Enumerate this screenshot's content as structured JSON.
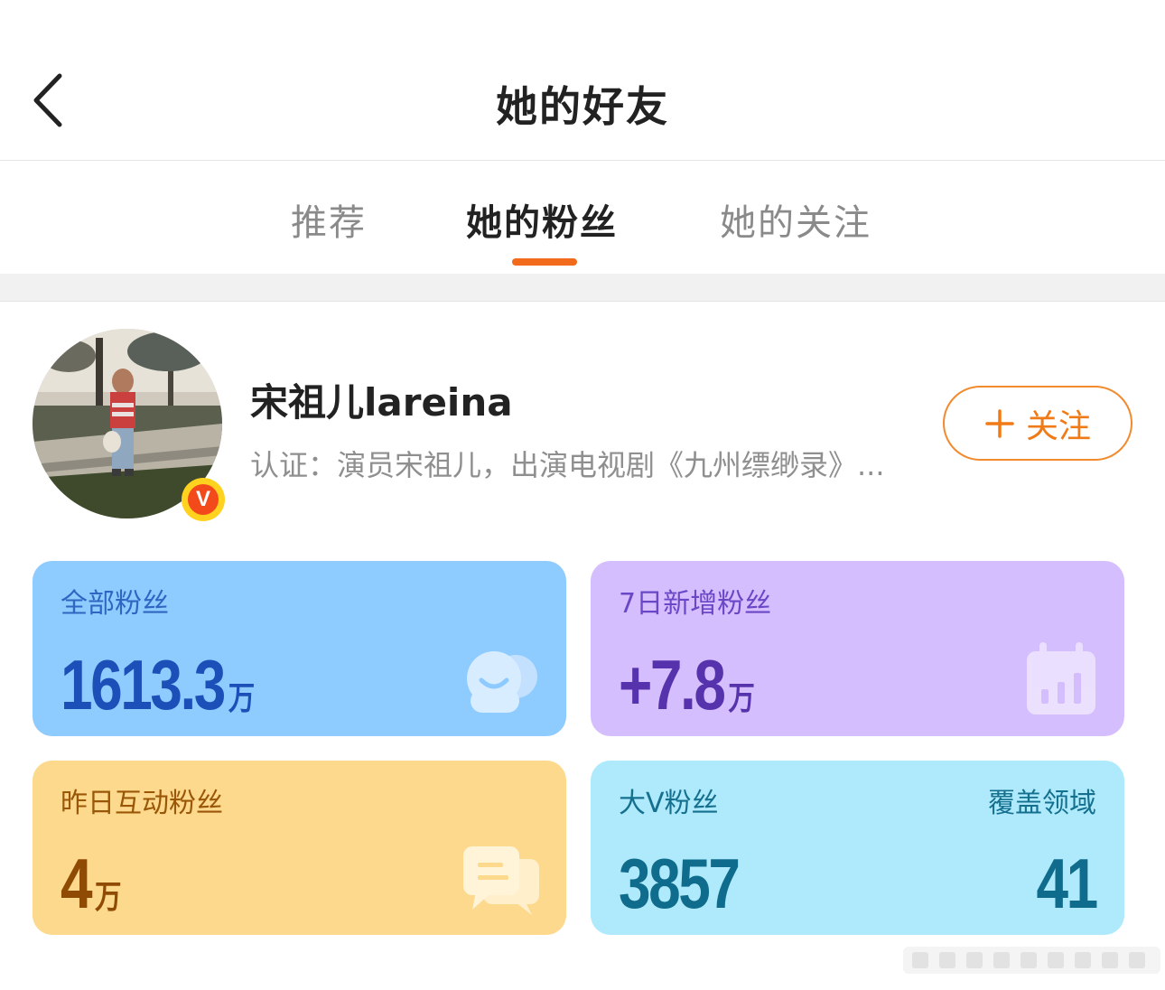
{
  "header": {
    "title": "她的好友"
  },
  "tabs": [
    {
      "label": "推荐",
      "active": false
    },
    {
      "label": "她的粉丝",
      "active": true
    },
    {
      "label": "她的关注",
      "active": false
    }
  ],
  "profile": {
    "name": "宋祖儿lareina",
    "description": "认证：演员宋祖儿，出演电视剧《九州缥缈录》...",
    "verified_badge": "V",
    "follow_button": {
      "icon": "plus-icon",
      "label": "关注"
    }
  },
  "stats": {
    "all_fans": {
      "label": "全部粉丝",
      "value": "1613.3",
      "unit": "万",
      "icon": "smile-icon"
    },
    "new_fans_7d": {
      "label": "7日新增粉丝",
      "value": "+7.8",
      "unit": "万",
      "icon": "calendar-chart-icon"
    },
    "active_fans_yesterday": {
      "label": "昨日互动粉丝",
      "value": "4",
      "unit": "万",
      "icon": "chat-icon"
    },
    "big_v_fans": {
      "label": "大V粉丝",
      "value": "3857",
      "coverage_label": "覆盖领域",
      "coverage_value": "41"
    }
  },
  "colors": {
    "accent": "#f26a1b",
    "card_blue": "#8ecbff",
    "card_purple": "#d5befd",
    "card_yellow": "#fdd98d",
    "card_cyan": "#aeeafb"
  }
}
